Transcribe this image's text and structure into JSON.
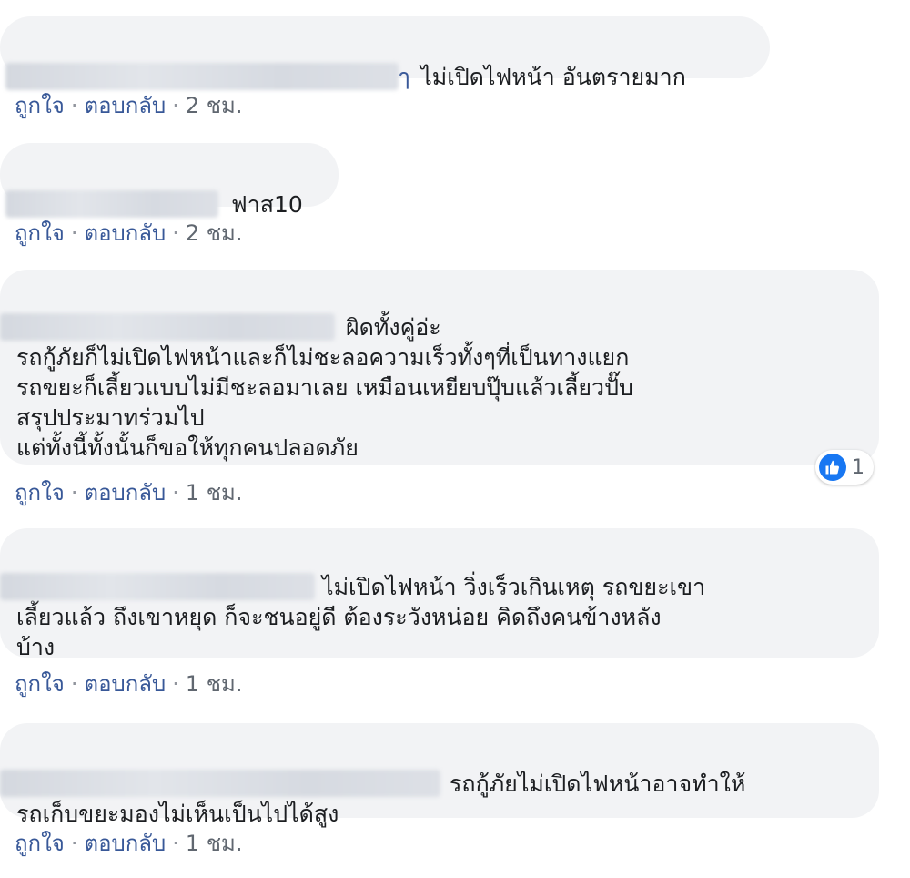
{
  "actions": {
    "like": "ถูกใจ",
    "reply": "ตอบกลับ",
    "separator": "·"
  },
  "comments": [
    {
      "first_line": "ไม่เปิดไฟหน้า อันตรายมาก",
      "author_tail": "ๅ",
      "body": "",
      "time": "2 ชม."
    },
    {
      "first_line": "ฟาส10",
      "body": "",
      "time": "2 ชม."
    },
    {
      "first_line": "ผิดทั้งคู่อ่ะ",
      "body": "รถกู้ภัยก็ไม่เปิดไฟหน้าและก็ไม่ชะลอความเร็วทั้งๆที่เป็นทางแยก\nรถขยะก็เลี้ยวแบบไม่มีชะลอมาเลย เหมือนเหยียบปุ๊บแล้วเลี้ยวปั๊บ\nสรุปประมาทร่วมไป\nแต่ทั้งนี้ทั้งนั้นก็ขอให้ทุกคนปลอดภัย",
      "time": "1 ชม.",
      "reaction_count": "1"
    },
    {
      "first_line": "ไม่เปิดไฟหน้า วิ่งเร็วเกินเหตุ รถขยะเขา",
      "body": "เลี้ยวแล้ว ถึงเขาหยุด ก็จะชนอยู่ดี ต้องระวังหน่อย คิดถึงคนข้างหลัง\nบ้าง",
      "time": "1 ชม."
    },
    {
      "first_line": "รถกู้ภัยไม่เปิดไฟหน้าอาจทำให้",
      "body": "รถเก็บขยะมองไม่เห็นเป็นไปได้สูง",
      "time": "1 ชม."
    }
  ],
  "colors": {
    "bubble": "#f2f3f5",
    "link": "#385898",
    "like_blue": "#1877f2"
  },
  "icons": {
    "reaction": "thumbs-up-icon"
  }
}
